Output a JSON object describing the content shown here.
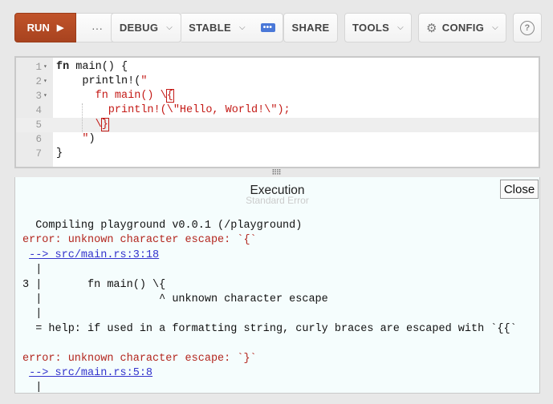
{
  "toolbar": {
    "run_label": "RUN",
    "more_label": "···",
    "debug_label": "DEBUG",
    "stable_label": "STABLE",
    "share_label": "SHARE",
    "tools_label": "TOOLS",
    "config_label": "CONFIG",
    "help_label": "?"
  },
  "editor": {
    "lines": [
      {
        "n": "1",
        "fold": true
      },
      {
        "n": "2",
        "fold": true
      },
      {
        "n": "3",
        "fold": true
      },
      {
        "n": "4",
        "fold": false
      },
      {
        "n": "5",
        "fold": false
      },
      {
        "n": "6",
        "fold": false
      },
      {
        "n": "7",
        "fold": false
      }
    ],
    "code": {
      "l1_kw": "fn",
      "l1_rest": " main() {",
      "l2_indent": "    ",
      "l2_macro": "println!(",
      "l2_str": "\"",
      "l3_str": "      fn main() \\",
      "l3_brace": "{",
      "l4_str": "        println!(\\\"Hello, World!\\\");",
      "l5_str": "      \\",
      "l5_brace": "}",
      "l6_str": "    \"",
      "l6_rest": ")",
      "l7": "}"
    }
  },
  "output": {
    "title": "Execution",
    "ghost_title": "Standard Error",
    "close_label": "Close",
    "lines": [
      {
        "text": "  Compiling playground v0.0.1 (/playground)",
        "kind": "plain"
      },
      {
        "text": "error: unknown character escape: `{`",
        "kind": "error"
      },
      {
        "prefix": " ",
        "text": "--> src/main.rs:3:18",
        "kind": "link"
      },
      {
        "text": "  |",
        "kind": "plain"
      },
      {
        "text": "3 |       fn main() \\{",
        "kind": "plain"
      },
      {
        "text": "  |                  ^ unknown character escape",
        "kind": "plain"
      },
      {
        "text": "  |",
        "kind": "plain"
      },
      {
        "text": "  = help: if used in a formatting string, curly braces are escaped with `{{`",
        "kind": "plain"
      },
      {
        "text": "",
        "kind": "plain"
      },
      {
        "text": "error: unknown character escape: `}`",
        "kind": "error"
      },
      {
        "prefix": " ",
        "text": "--> src/main.rs:5:8",
        "kind": "link"
      },
      {
        "text": "  |",
        "kind": "plain"
      }
    ]
  }
}
